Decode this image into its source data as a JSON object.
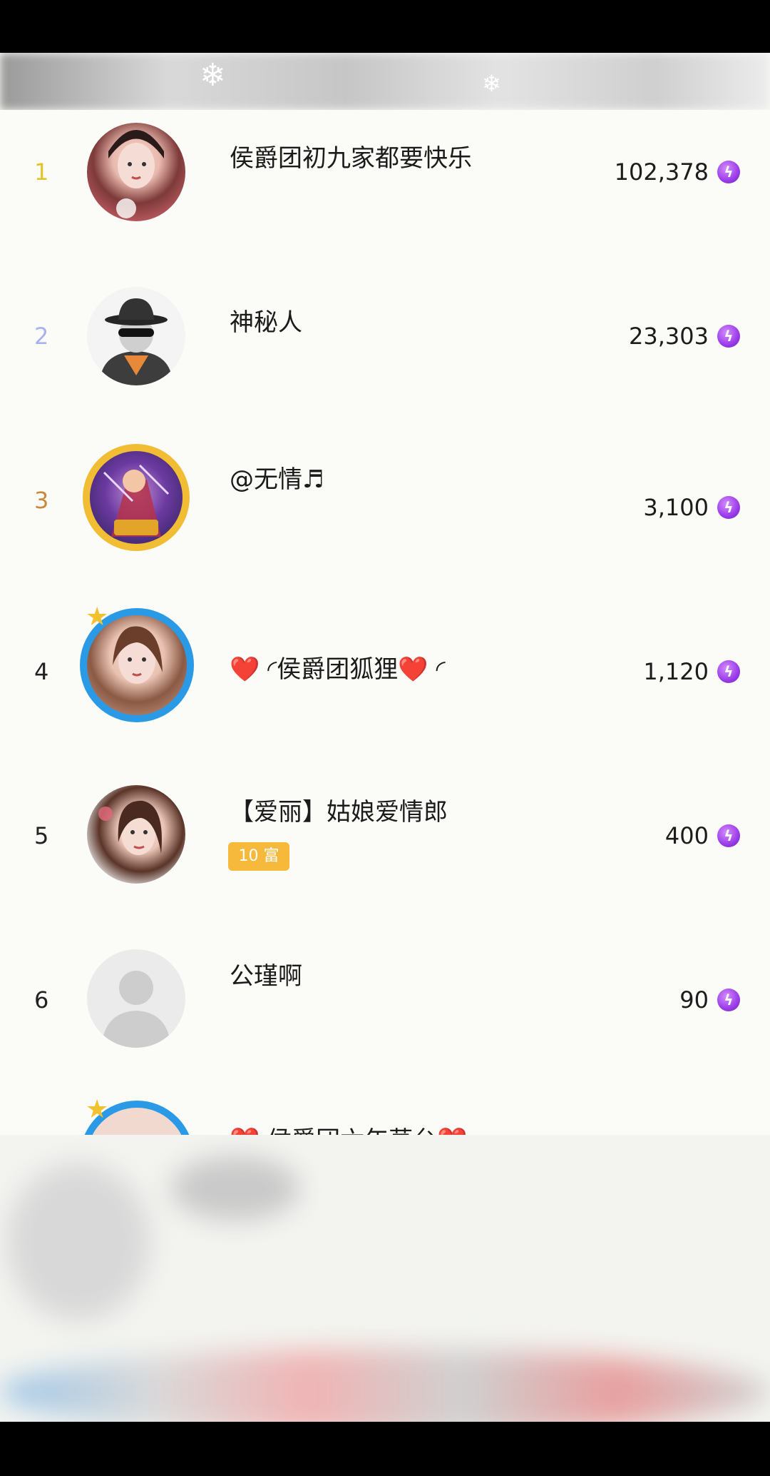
{
  "ranking": [
    {
      "rank": "1",
      "rank_color": "#e6c22a",
      "name": "侯爵团初九家都要快乐",
      "score": "102,378",
      "avatar": "woman-portrait-avatar"
    },
    {
      "rank": "2",
      "rank_color": "#a9b2f0",
      "name": "神秘人",
      "score": "23,303",
      "avatar": "mystery-man-avatar"
    },
    {
      "rank": "3",
      "rank_color": "#c8893a",
      "name": "@无情♬",
      "score": "3,100",
      "avatar": "game-hero-avatar"
    },
    {
      "rank": "4",
      "rank_color": "#222222",
      "name": "❤️ ◜侯爵团狐狸❤️ ◜",
      "score": "1,120",
      "avatar": "woman-portrait-avatar"
    },
    {
      "rank": "5",
      "rank_color": "#222222",
      "name": "【爱丽】姑娘爱情郎",
      "score": "400",
      "badge": "10 富",
      "avatar": "woman-portrait-avatar"
    },
    {
      "rank": "6",
      "rank_color": "#222222",
      "name": "公瑾啊",
      "score": "90",
      "avatar": "default-user-avatar"
    },
    {
      "rank": "",
      "rank_color": "#222222",
      "name": "❤️ 侯爵团六年草台❤️",
      "score": "",
      "avatar": "woman-portrait-avatar"
    }
  ],
  "coin_icon": "lightning-coin-icon",
  "accent_purple": "#9a3ce8"
}
